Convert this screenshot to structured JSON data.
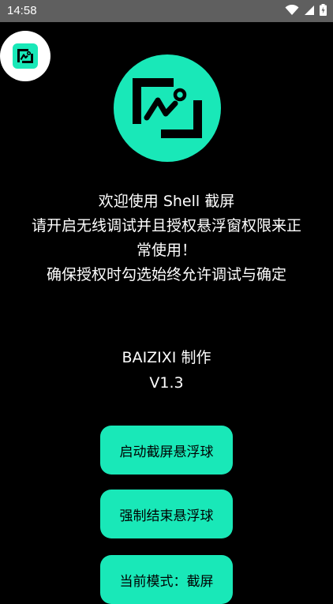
{
  "status_bar": {
    "time": "14:58",
    "icons": [
      "wifi-icon",
      "signal-icon",
      "battery-icon"
    ],
    "background": "#5f5f5f"
  },
  "app": {
    "accent_color": "#19e8b8",
    "icon_name": "screenshot-image-icon"
  },
  "intro": {
    "line1": "欢迎使用 Shell 截屏",
    "line2": "请开启无线调试并且授权悬浮窗权限来正",
    "line3": "常使用！",
    "line4": "确保授权时勾选始终允许调试与确定"
  },
  "meta": {
    "author": "BAIZIXI 制作",
    "version": "V1.3"
  },
  "buttons": {
    "start": "启动截屏悬浮球",
    "stop": "强制结束悬浮球",
    "mode": "当前模式：截屏"
  }
}
